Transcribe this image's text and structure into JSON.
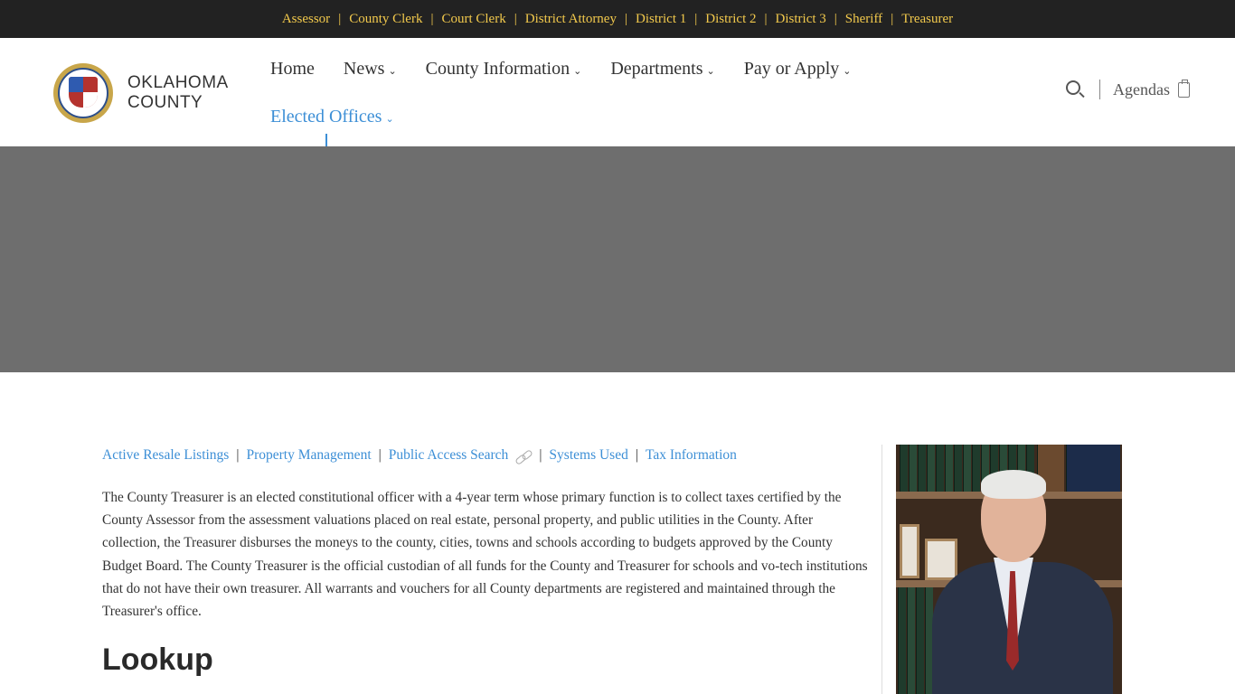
{
  "topbar": {
    "links": [
      "Assessor",
      "County Clerk",
      "Court Clerk",
      "District Attorney",
      "District 1",
      "District 2",
      "District 3",
      "Sheriff",
      "Treasurer"
    ],
    "separator": "|",
    "color": "#f2c94c",
    "background": "#222222"
  },
  "logo": {
    "line1": "OKLAHOMA",
    "line2": "COUNTY",
    "icon": "county-seal-icon"
  },
  "nav": {
    "items": [
      {
        "label": "Home",
        "has_dropdown": false
      },
      {
        "label": "News",
        "has_dropdown": true
      },
      {
        "label": "County Information",
        "has_dropdown": true
      },
      {
        "label": "Departments",
        "has_dropdown": true
      },
      {
        "label": "Pay or Apply",
        "has_dropdown": true
      },
      {
        "label": "Elected Offices",
        "has_dropdown": true,
        "active": true
      }
    ],
    "chevron": "⌄",
    "active_color": "#3d8fd6"
  },
  "header_right": {
    "search_icon": "search-icon",
    "agendas_label": "Agendas",
    "agendas_icon": "clipboard-icon"
  },
  "banner": {
    "color": "#6e6e6e"
  },
  "content": {
    "sublinks": [
      {
        "label": "Active Resale Listings"
      },
      {
        "label": "Property Management"
      },
      {
        "label": "Public Access Search",
        "icon": "external-link-icon"
      },
      {
        "label": "Systems Used"
      },
      {
        "label": "Tax Information"
      }
    ],
    "separator": "|",
    "body": "The County Treasurer is an elected constitutional officer with a 4-year term whose primary function is to collect taxes certified by the County Assessor from the assessment valuations placed on real estate, personal property, and public utilities in the County. After collection, the Treasurer disburses the moneys to the county, cities, towns and schools according to budgets approved by the County Budget Board. The County Treasurer is the official custodian of all funds for the County and Treasurer for schools and vo-tech institutions that do not have their own treasurer. All warrants and vouchers for all County departments are registered and maintained through the Treasurer's office.",
    "heading": "Lookup"
  }
}
